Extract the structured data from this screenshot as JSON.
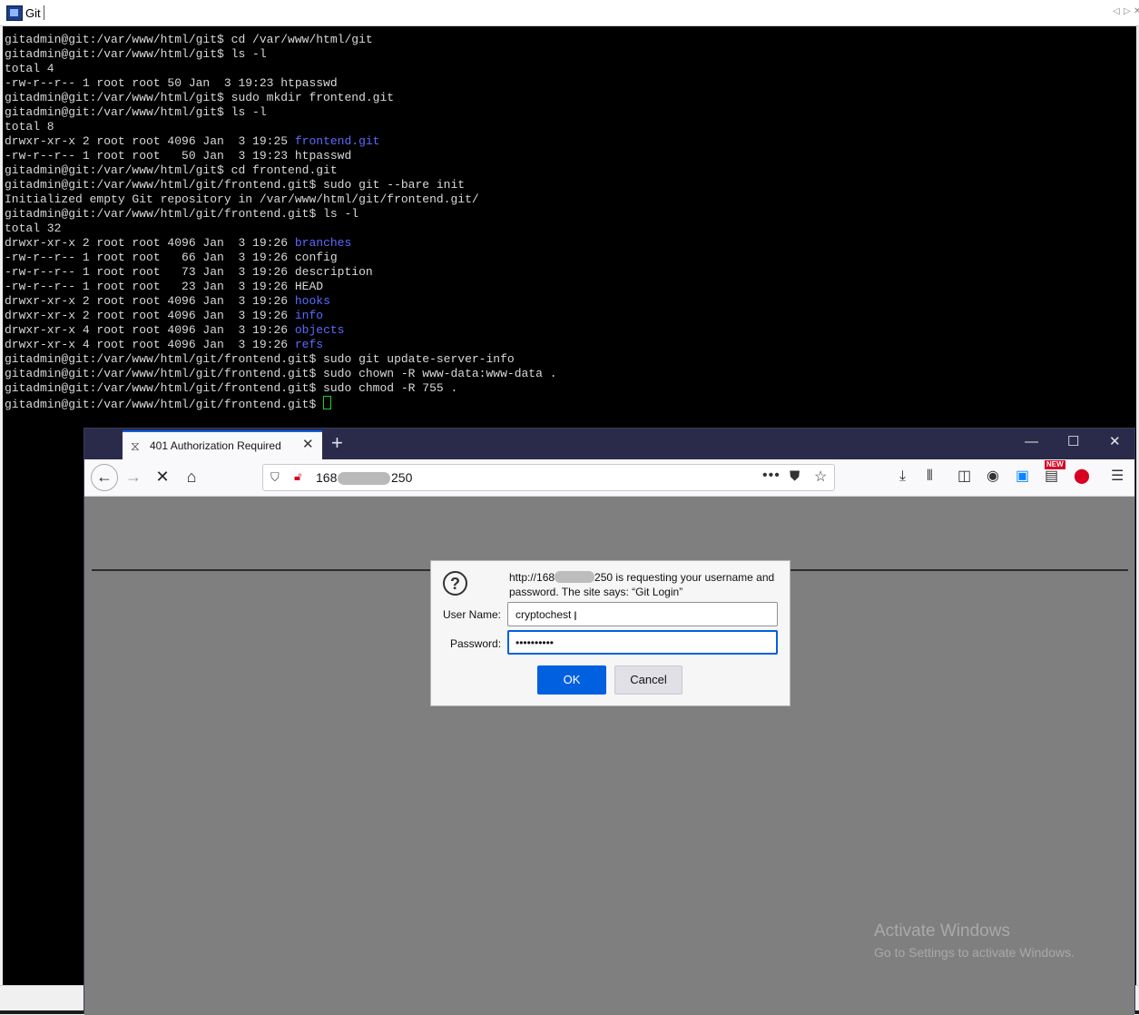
{
  "terminal_window": {
    "title": "Git",
    "lines": [
      {
        "segments": [
          {
            "text": "gitadmin@git:/var/www/html/git$ cd /var/www/html/git"
          }
        ]
      },
      {
        "segments": [
          {
            "text": "gitadmin@git:/var/www/html/git$ ls -l"
          }
        ]
      },
      {
        "segments": [
          {
            "text": "total 4"
          }
        ]
      },
      {
        "segments": [
          {
            "text": "-rw-r--r-- 1 root root 50 Jan  3 19:23 htpasswd"
          }
        ]
      },
      {
        "segments": [
          {
            "text": "gitadmin@git:/var/www/html/git$ sudo mkdir frontend.git"
          }
        ]
      },
      {
        "segments": [
          {
            "text": "gitadmin@git:/var/www/html/git$ ls -l"
          }
        ]
      },
      {
        "segments": [
          {
            "text": "total 8"
          }
        ]
      },
      {
        "segments": [
          {
            "text": "drwxr-xr-x 2 root root 4096 Jan  3 19:25 "
          },
          {
            "text": "frontend.git",
            "dir": true
          }
        ]
      },
      {
        "segments": [
          {
            "text": "-rw-r--r-- 1 root root   50 Jan  3 19:23 htpasswd"
          }
        ]
      },
      {
        "segments": [
          {
            "text": "gitadmin@git:/var/www/html/git$ cd frontend.git"
          }
        ]
      },
      {
        "segments": [
          {
            "text": "gitadmin@git:/var/www/html/git/frontend.git$ sudo git --bare init"
          }
        ]
      },
      {
        "segments": [
          {
            "text": "Initialized empty Git repository in /var/www/html/git/frontend.git/"
          }
        ]
      },
      {
        "segments": [
          {
            "text": "gitadmin@git:/var/www/html/git/frontend.git$ ls -l"
          }
        ]
      },
      {
        "segments": [
          {
            "text": "total 32"
          }
        ]
      },
      {
        "segments": [
          {
            "text": "drwxr-xr-x 2 root root 4096 Jan  3 19:26 "
          },
          {
            "text": "branches",
            "dir": true
          }
        ]
      },
      {
        "segments": [
          {
            "text": "-rw-r--r-- 1 root root   66 Jan  3 19:26 config"
          }
        ]
      },
      {
        "segments": [
          {
            "text": "-rw-r--r-- 1 root root   73 Jan  3 19:26 description"
          }
        ]
      },
      {
        "segments": [
          {
            "text": "-rw-r--r-- 1 root root   23 Jan  3 19:26 HEAD"
          }
        ]
      },
      {
        "segments": [
          {
            "text": "drwxr-xr-x 2 root root 4096 Jan  3 19:26 "
          },
          {
            "text": "hooks",
            "dir": true
          }
        ]
      },
      {
        "segments": [
          {
            "text": "drwxr-xr-x 2 root root 4096 Jan  3 19:26 "
          },
          {
            "text": "info",
            "dir": true
          }
        ]
      },
      {
        "segments": [
          {
            "text": "drwxr-xr-x 4 root root 4096 Jan  3 19:26 "
          },
          {
            "text": "objects",
            "dir": true
          }
        ]
      },
      {
        "segments": [
          {
            "text": "drwxr-xr-x 4 root root 4096 Jan  3 19:26 "
          },
          {
            "text": "refs",
            "dir": true
          }
        ]
      },
      {
        "segments": [
          {
            "text": "gitadmin@git:/var/www/html/git/frontend.git$ sudo git update-server-info"
          }
        ]
      },
      {
        "segments": [
          {
            "text": "gitadmin@git:/var/www/html/git/frontend.git$ sudo chown -R www-data:www-data ."
          }
        ]
      },
      {
        "segments": [
          {
            "text": "gitadmin@git:/var/www/html/git/frontend.git$ sudo chmod -R 755 ."
          }
        ]
      },
      {
        "segments": [
          {
            "text": "gitadmin@git:/var/www/html/git/frontend.git$ "
          }
        ],
        "cursor": true
      }
    ]
  },
  "browser": {
    "tab": {
      "title": "401 Authorization Required"
    },
    "url": {
      "visible_start": "168",
      "visible_end": "250"
    },
    "new_badge": "NEW"
  },
  "auth_dialog": {
    "message_start": "http://168",
    "message_end": "250 is requesting your username and password. The site says: “Git Login”",
    "username_label": "User Name:",
    "username_value": "cryptochest",
    "password_label": "Password:",
    "password_value": "••••••••••",
    "ok_label": "OK",
    "cancel_label": "Cancel"
  },
  "watermark": {
    "title": "Activate Windows",
    "subtitle": "Go to Settings to activate Windows."
  },
  "colors": {
    "terminal_bg": "#000000",
    "terminal_text": "#d9d9d9",
    "directory_text": "#5a6bff",
    "cursor": "#22d022",
    "accent": "#0060df"
  }
}
